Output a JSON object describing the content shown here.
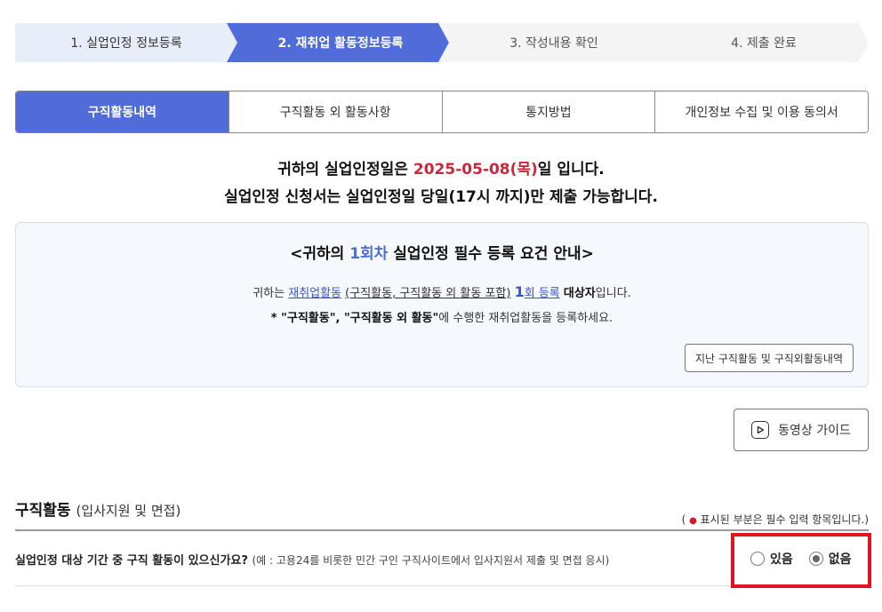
{
  "steps": [
    {
      "label": "1. 실업인정 정보등록"
    },
    {
      "label": "2. 재취업 활동정보등록"
    },
    {
      "label": "3. 작성내용 확인"
    },
    {
      "label": "4. 제출 완료"
    }
  ],
  "tabs": [
    {
      "label": "구직활동내역"
    },
    {
      "label": "구직활동 외 활동사항"
    },
    {
      "label": "통지방법"
    },
    {
      "label": "개인정보 수집 및 이용 동의서"
    }
  ],
  "notice": {
    "line1_prefix": "귀하의 실업인정일은 ",
    "date": "2025-05-08(목)",
    "line1_suffix": "일 입니다.",
    "line2": "실업인정 신청서는 실업인정일 당일(17시 까지)만 제출 가능합니다."
  },
  "info": {
    "title_prefix": "<귀하의 ",
    "title_accent": "1회차",
    "title_suffix": " 실업인정 필수 등록 요건 안내>",
    "line1": {
      "prefix": "귀하는 ",
      "link": "재취업활동",
      "paren": "(구직활동, 구직활동 외 활동 포함)",
      "count": "1",
      "count_unit": "회 등록",
      "target": "대상자",
      "suffix": "입니다."
    },
    "line2": {
      "star": "* ",
      "bold": "\"구직활동\", \"구직활동 외 활동\"",
      "rest": "에 수행한 재취업활동을 등록하세요."
    },
    "history_button": "지난 구직활동 및 구직외활동내역"
  },
  "video_button": "동영상 가이드",
  "section": {
    "title": "구직활동",
    "subtitle": "(입사지원 및 면접)",
    "required_open": "(",
    "required_dot": "●",
    "required_text": " 표시된 부분은 필수 입력 항목입니다.)"
  },
  "question": {
    "text": "실업인정 대상 기간 중 구직 활동이 있으신가요?",
    "example": "(예 : 고용24를 비롯한 민간 구인 구직사이트에서 입사지원서 제출 및 면접 응시)",
    "options": [
      {
        "label": "있음",
        "selected": false
      },
      {
        "label": "없음",
        "selected": true
      }
    ]
  },
  "colors": {
    "primary": "#4f6cd9",
    "date_red": "#c8283a",
    "highlight_red": "#e0131e"
  }
}
